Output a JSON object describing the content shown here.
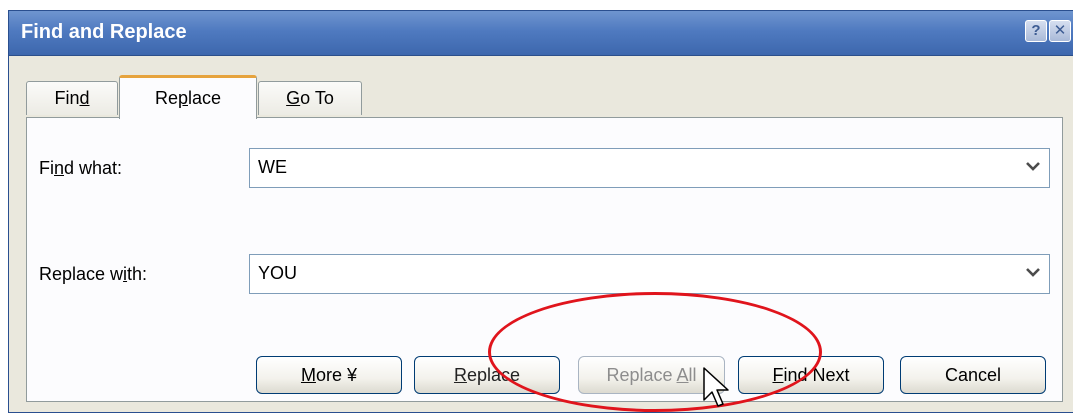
{
  "dialog": {
    "title": "Find and Replace",
    "help_glyph": "?",
    "close_glyph": "✕"
  },
  "tabs": [
    {
      "label_pre": "Fin",
      "label_u": "d",
      "label_post": "",
      "active": false
    },
    {
      "label_pre": "Re",
      "label_u": "p",
      "label_post": "lace",
      "active": true
    },
    {
      "label_pre": "",
      "label_u": "G",
      "label_post": "o To",
      "active": false
    }
  ],
  "find": {
    "label_pre": "Fi",
    "label_u": "n",
    "label_post": "d what:",
    "value": "WE",
    "arrow_icon": "chevron-down-icon"
  },
  "replace": {
    "label_pre": "Replace w",
    "label_u": "i",
    "label_post": "th:",
    "value": "YOU",
    "arrow_icon": "chevron-down-icon"
  },
  "buttons": {
    "more": {
      "pre": "",
      "u": "M",
      "post": "ore",
      "glyph": "¥"
    },
    "replace": {
      "pre": "",
      "u": "R",
      "post": "eplace"
    },
    "replace_all": {
      "pre": "Replace ",
      "u": "A",
      "post": "ll",
      "disabled": true
    },
    "find_next": {
      "pre": "",
      "u": "F",
      "post": "ind Next"
    },
    "cancel": {
      "label": "Cancel"
    }
  },
  "annotation": {
    "color": "#e0141c"
  },
  "colors": {
    "titlebar": "#4f7ac0",
    "tab_active_accent": "#e6a33d",
    "dialog_face": "#eae8dd"
  }
}
